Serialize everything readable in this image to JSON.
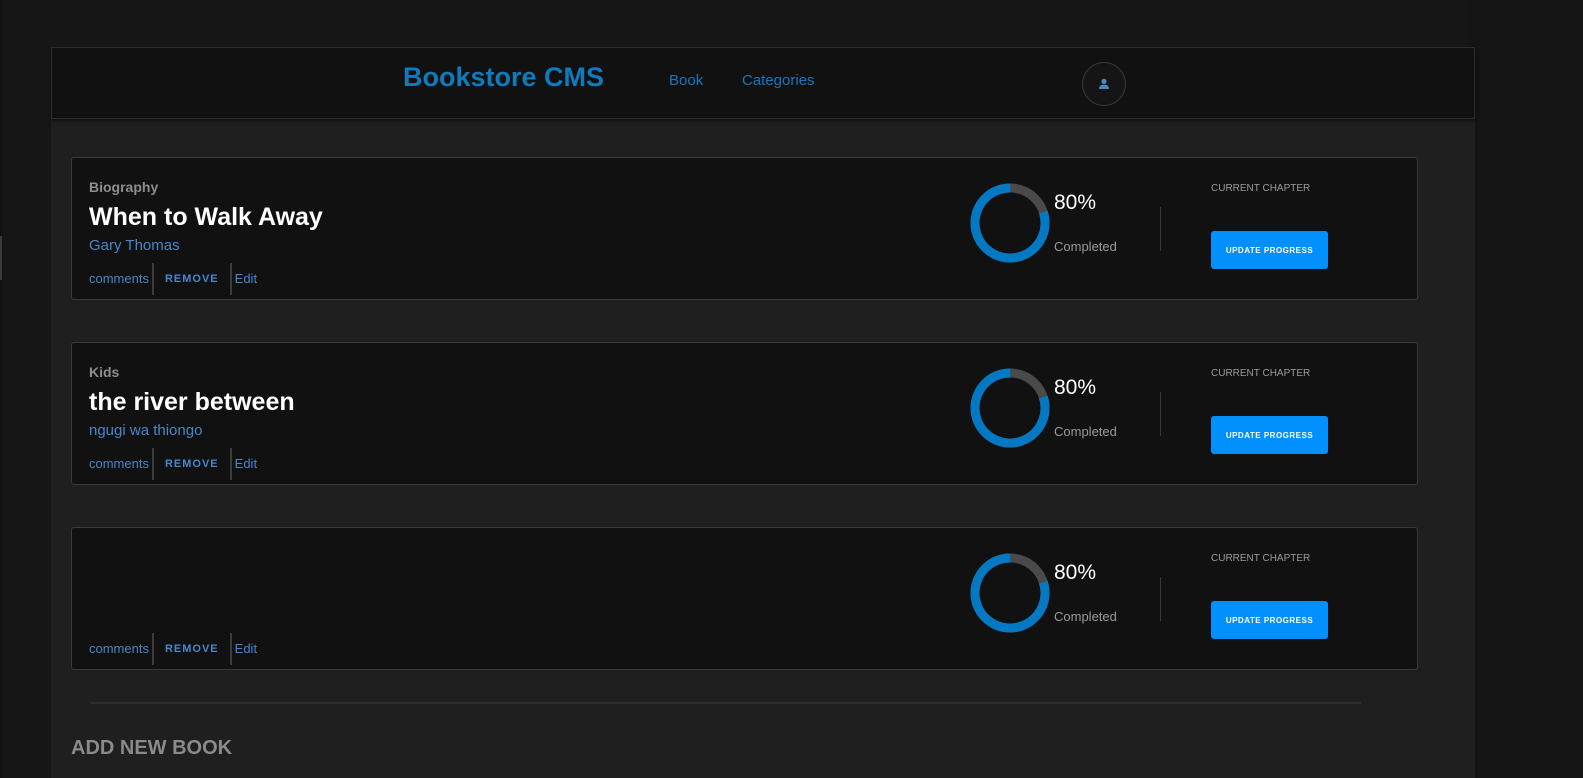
{
  "header": {
    "brand": "Bookstore CMS",
    "nav": [
      {
        "label": "Book"
      },
      {
        "label": "Categories"
      }
    ],
    "avatar_icon": "user-icon"
  },
  "books": [
    {
      "category": "Biography",
      "title": "When to Walk Away",
      "author": "Gary Thomas",
      "actions": {
        "comments": "comments",
        "remove": "REMOVE",
        "edit": "Edit"
      },
      "progress": {
        "fraction": 0.8,
        "percent_label": "80%",
        "status": "Completed"
      },
      "chapter": {
        "label": "CURRENT CHAPTER",
        "button": "UPDATE PROGRESS"
      }
    },
    {
      "category": "Kids",
      "title": "the river between",
      "author": "ngugi wa thiongo",
      "actions": {
        "comments": "comments",
        "remove": "REMOVE",
        "edit": "Edit"
      },
      "progress": {
        "fraction": 0.8,
        "percent_label": "80%",
        "status": "Completed"
      },
      "chapter": {
        "label": "CURRENT CHAPTER",
        "button": "UPDATE PROGRESS"
      }
    },
    {
      "category": "",
      "title": "",
      "author": "",
      "actions": {
        "comments": "comments",
        "remove": "REMOVE",
        "edit": "Edit"
      },
      "progress": {
        "fraction": 0.8,
        "percent_label": "80%",
        "status": "Completed"
      },
      "chapter": {
        "label": "CURRENT CHAPTER",
        "button": "UPDATE PROGRESS"
      }
    }
  ],
  "add_book": {
    "heading": "ADD NEW BOOK"
  },
  "colors": {
    "accent": "#0290ff",
    "brand": "#0e7bbd",
    "link": "#4a86c8",
    "progress_ring": "#0379c4",
    "progress_track": "#4a4a4a"
  }
}
